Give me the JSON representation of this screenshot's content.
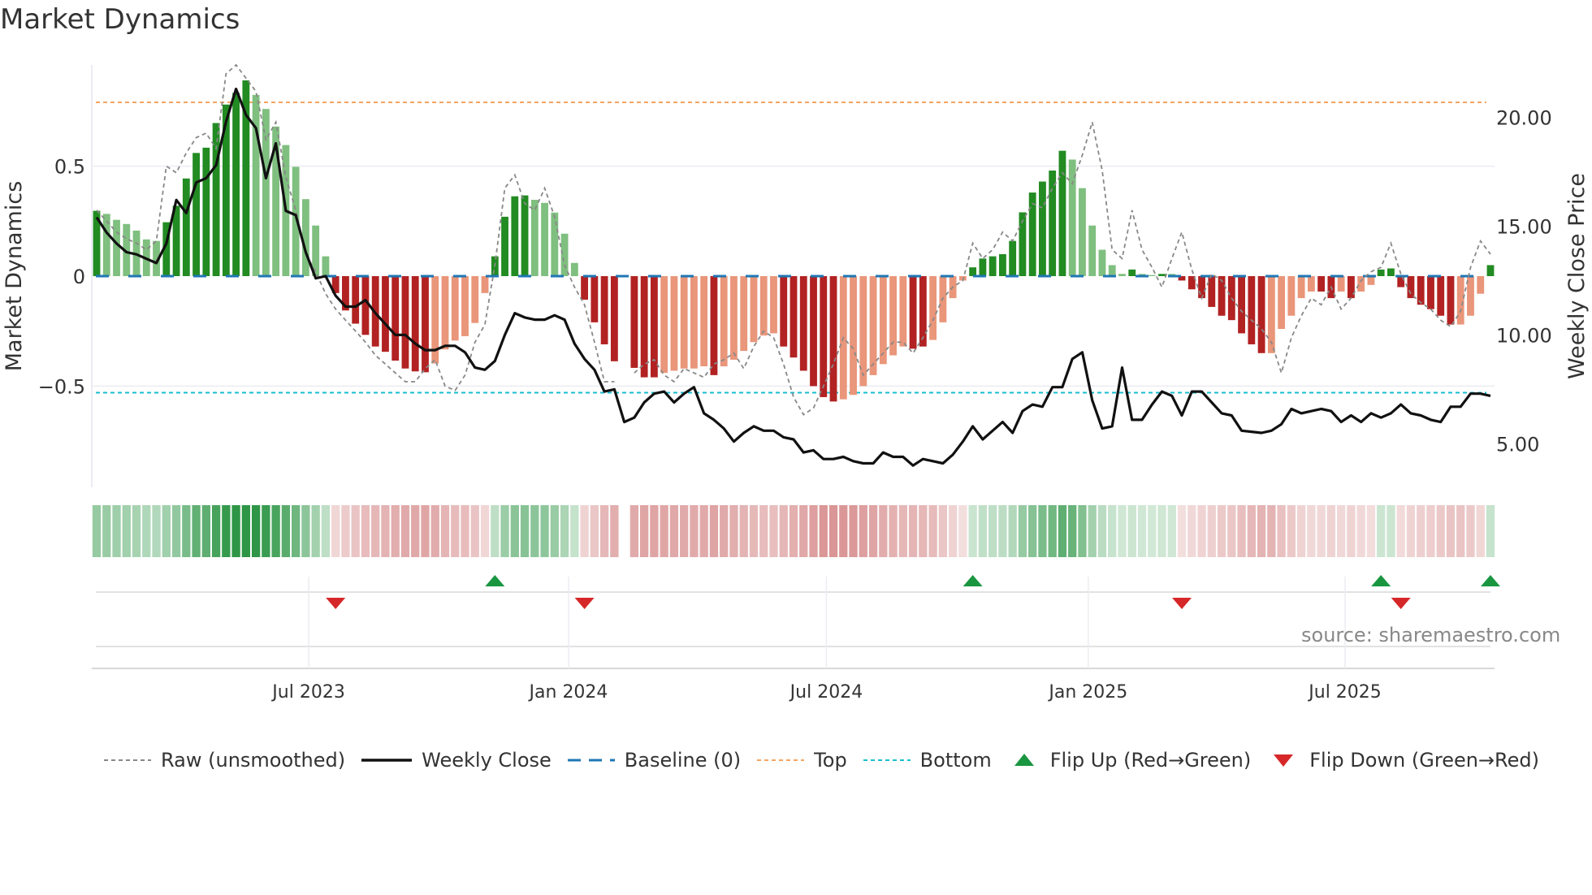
{
  "title": "Market Dynamics",
  "source": "source: sharemaestro.com",
  "legend": {
    "raw": "Raw (unsmoothed)",
    "close": "Weekly Close",
    "baseline": "Baseline (0)",
    "top": "Top",
    "bottom": "Bottom",
    "flip_up": "Flip Up (Red→Green)",
    "flip_down": "Flip Down (Green→Red)"
  },
  "colors": {
    "green_strong": "#228b22",
    "green_weak": "#7fbf7f",
    "red_strong": "#b22222",
    "red_weak": "#e9967a",
    "raw": "#888888",
    "close": "#111111",
    "baseline": "#1f77b4",
    "top": "#f4a460",
    "bottom": "#17becf",
    "flip_up": "#1a9641",
    "flip_down": "#d62728"
  },
  "chart_data": {
    "type": "bar+line",
    "title": "Market Dynamics",
    "ylabel": "Market Dynamics",
    "y2label": "Weekly Close Price",
    "ylim": [
      -0.96,
      0.96
    ],
    "y2lim": [
      3.0,
      22.4
    ],
    "y_ticks": [
      {
        "v": 0.5,
        "label": "0.5"
      },
      {
        "v": 0,
        "label": "0"
      },
      {
        "v": -0.5,
        "label": "−0.5"
      }
    ],
    "y2_ticks": [
      {
        "v": 20,
        "label": "20.00"
      },
      {
        "v": 15,
        "label": "15.00"
      },
      {
        "v": 10,
        "label": "10.00"
      },
      {
        "v": 5,
        "label": "5.00"
      }
    ],
    "x_ticks": [
      {
        "week": 21.3,
        "label": "Jul 2023"
      },
      {
        "week": 47.4,
        "label": "Jan 2024"
      },
      {
        "week": 73.3,
        "label": "Jul 2024"
      },
      {
        "week": 99.6,
        "label": "Jan 2025"
      },
      {
        "week": 125.4,
        "label": "Jul 2025"
      }
    ],
    "top_level": 0.79,
    "bottom_level": -0.53,
    "baseline": 0,
    "momentum": [
      0.297,
      0.283,
      0.256,
      0.237,
      0.207,
      0.167,
      0.16,
      0.245,
      0.32,
      0.444,
      0.56,
      0.584,
      0.696,
      0.78,
      0.833,
      0.89,
      0.824,
      0.76,
      0.68,
      0.596,
      0.497,
      0.35,
      0.23,
      0.09,
      -0.077,
      -0.156,
      -0.216,
      -0.267,
      -0.32,
      -0.344,
      -0.384,
      -0.42,
      -0.433,
      -0.437,
      -0.397,
      -0.333,
      -0.293,
      -0.273,
      -0.213,
      -0.077,
      0.09,
      0.27,
      0.363,
      0.367,
      0.347,
      0.333,
      0.289,
      0.193,
      0.06,
      -0.107,
      -0.21,
      -0.31,
      -0.387,
      null,
      -0.417,
      -0.46,
      -0.46,
      -0.44,
      -0.43,
      -0.42,
      -0.42,
      -0.41,
      -0.45,
      -0.41,
      -0.38,
      -0.34,
      -0.3,
      -0.27,
      -0.26,
      -0.32,
      -0.37,
      -0.43,
      -0.5,
      -0.55,
      -0.57,
      -0.56,
      -0.54,
      -0.5,
      -0.45,
      -0.4,
      -0.36,
      -0.32,
      -0.33,
      -0.32,
      -0.29,
      -0.21,
      -0.1,
      -0.02,
      0.04,
      0.08,
      0.09,
      0.1,
      0.16,
      0.29,
      0.38,
      0.43,
      0.48,
      0.57,
      0.53,
      0.4,
      0.23,
      0.12,
      0.05,
      0.01,
      0.03,
      0.01,
      0.005,
      0.01,
      0.01,
      -0.02,
      -0.06,
      -0.1,
      -0.14,
      -0.18,
      -0.2,
      -0.26,
      -0.31,
      -0.35,
      -0.35,
      -0.24,
      -0.18,
      -0.1,
      -0.07,
      -0.07,
      -0.1,
      -0.07,
      -0.1,
      -0.07,
      -0.04,
      0.03,
      0.035,
      -0.05,
      -0.1,
      -0.13,
      -0.15,
      -0.18,
      -0.22,
      -0.22,
      -0.18,
      -0.08,
      0.05
    ],
    "strengthening": [
      1,
      0,
      0,
      0,
      0,
      0,
      0,
      1,
      1,
      1,
      1,
      1,
      1,
      1,
      1,
      1,
      0,
      0,
      0,
      0,
      0,
      0,
      0,
      0,
      1,
      1,
      1,
      1,
      1,
      1,
      1,
      1,
      1,
      1,
      0,
      0,
      0,
      0,
      0,
      0,
      1,
      1,
      1,
      1,
      0,
      0,
      0,
      0,
      0,
      1,
      1,
      1,
      1,
      0,
      1,
      1,
      1,
      0,
      0,
      0,
      0,
      0,
      1,
      0,
      0,
      0,
      0,
      0,
      0,
      1,
      1,
      1,
      1,
      1,
      1,
      0,
      0,
      0,
      0,
      0,
      0,
      0,
      1,
      1,
      0,
      0,
      0,
      0,
      1,
      1,
      1,
      1,
      1,
      1,
      1,
      1,
      1,
      1,
      0,
      0,
      0,
      0,
      0,
      0,
      1,
      0,
      0,
      1,
      0,
      1,
      1,
      1,
      1,
      1,
      1,
      1,
      1,
      1,
      0,
      0,
      0,
      0,
      0,
      1,
      1,
      0,
      1,
      0,
      0,
      1,
      1,
      1,
      1,
      1,
      1,
      1,
      1,
      0,
      0,
      0,
      1
    ],
    "raw": [
      0.3,
      0.25,
      0.2,
      0.17,
      0.15,
      0.12,
      0.16,
      0.5,
      0.47,
      0.56,
      0.63,
      0.65,
      0.58,
      0.92,
      0.96,
      0.9,
      0.84,
      0.62,
      0.7,
      0.45,
      0.3,
      0.1,
      0.02,
      -0.08,
      -0.15,
      -0.2,
      -0.25,
      -0.3,
      -0.36,
      -0.4,
      -0.44,
      -0.48,
      -0.48,
      -0.42,
      -0.38,
      -0.5,
      -0.52,
      -0.45,
      -0.3,
      -0.22,
      0.05,
      0.4,
      0.46,
      0.33,
      0.3,
      0.4,
      0.27,
      0.05,
      -0.05,
      -0.13,
      -0.3,
      -0.48,
      -0.48,
      null,
      -0.44,
      -0.4,
      -0.38,
      -0.45,
      -0.48,
      -0.42,
      -0.44,
      -0.46,
      -0.4,
      -0.38,
      -0.35,
      -0.42,
      -0.32,
      -0.25,
      -0.28,
      -0.4,
      -0.55,
      -0.63,
      -0.6,
      -0.5,
      -0.4,
      -0.28,
      -0.33,
      -0.45,
      -0.4,
      -0.35,
      -0.3,
      -0.3,
      -0.35,
      -0.28,
      -0.2,
      -0.1,
      -0.05,
      -0.02,
      0.15,
      0.08,
      0.12,
      0.2,
      0.16,
      0.25,
      0.33,
      0.31,
      0.4,
      0.47,
      0.42,
      0.55,
      0.7,
      0.48,
      0.12,
      0.08,
      0.3,
      0.12,
      0.04,
      -0.05,
      0.08,
      0.2,
      0.03,
      -0.1,
      0.01,
      -0.02,
      -0.1,
      -0.16,
      -0.2,
      -0.24,
      -0.3,
      -0.44,
      -0.28,
      -0.18,
      -0.1,
      -0.13,
      -0.05,
      -0.15,
      -0.1,
      -0.02,
      0.02,
      0.04,
      0.15,
      0.01,
      -0.08,
      -0.12,
      -0.15,
      -0.2,
      -0.23,
      -0.16,
      0.04,
      0.16,
      0.1
    ],
    "close": [
      15.4,
      14.7,
      14.2,
      13.8,
      13.7,
      13.5,
      13.3,
      14.2,
      16.2,
      15.6,
      17.0,
      17.2,
      17.8,
      19.8,
      21.3,
      20.1,
      19.5,
      17.2,
      18.8,
      15.7,
      15.5,
      13.8,
      12.6,
      12.7,
      11.8,
      11.3,
      11.3,
      11.6,
      11.0,
      10.5,
      10.0,
      10.0,
      9.6,
      9.3,
      9.3,
      9.5,
      9.5,
      9.2,
      8.5,
      8.4,
      8.8,
      10.0,
      11.0,
      10.8,
      10.7,
      10.7,
      10.9,
      10.7,
      9.6,
      8.9,
      8.4,
      7.4,
      7.5,
      6.0,
      6.2,
      6.9,
      7.3,
      7.4,
      6.9,
      7.3,
      7.6,
      6.4,
      6.1,
      5.7,
      5.1,
      5.5,
      5.8,
      5.6,
      5.6,
      5.3,
      5.2,
      4.6,
      4.7,
      4.3,
      4.3,
      4.4,
      4.2,
      4.1,
      4.1,
      4.6,
      4.4,
      4.4,
      4.0,
      4.3,
      4.2,
      4.1,
      4.5,
      5.1,
      5.8,
      5.2,
      5.6,
      6.0,
      5.5,
      6.5,
      6.8,
      6.7,
      7.6,
      7.6,
      8.9,
      9.2,
      7.0,
      5.7,
      5.8,
      8.5,
      6.1,
      6.1,
      6.8,
      7.4,
      7.2,
      6.3,
      7.4,
      7.4,
      6.9,
      6.4,
      6.3,
      5.6,
      5.55,
      5.5,
      5.6,
      5.9,
      6.6,
      6.4,
      6.5,
      6.6,
      6.5,
      6.0,
      6.3,
      6.0,
      6.4,
      6.2,
      6.4,
      6.8,
      6.4,
      6.3,
      6.1,
      6.0,
      6.7,
      6.7,
      7.3,
      7.3,
      7.2
    ],
    "flips_up": [
      40,
      88,
      129,
      140
    ],
    "flips_down": [
      24,
      49,
      109,
      131
    ]
  }
}
